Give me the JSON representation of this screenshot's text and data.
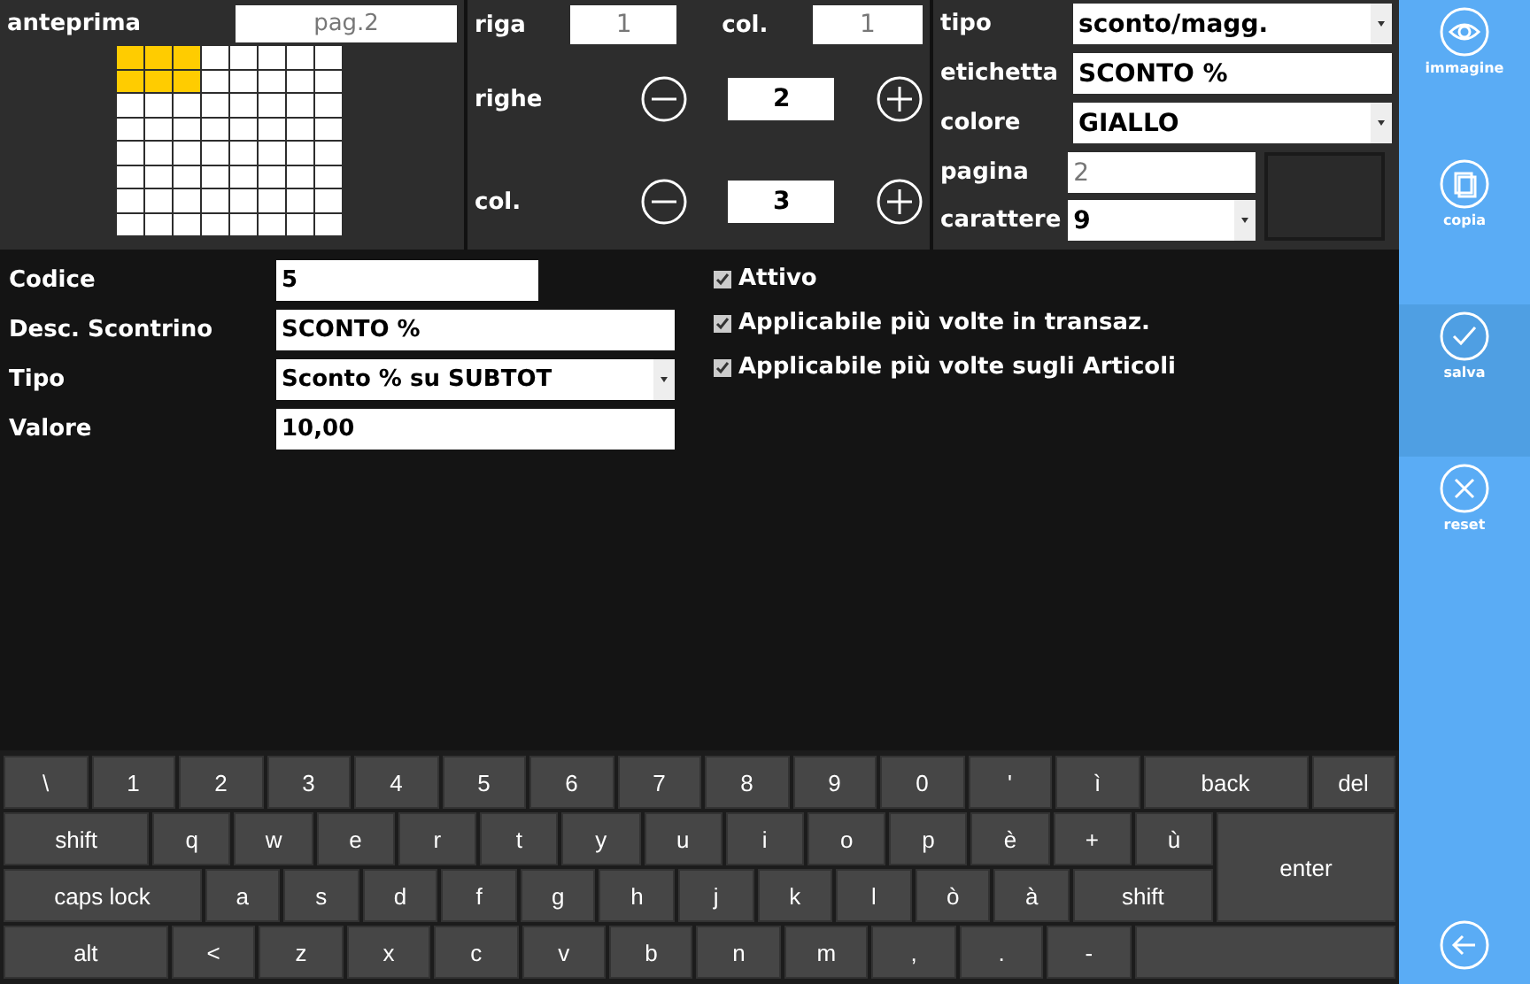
{
  "preview": {
    "label": "anteprima",
    "page": "pag.2"
  },
  "position": {
    "riga_label": "riga",
    "riga": "1",
    "col_label": "col.",
    "col": "1",
    "righe_label": "righe",
    "righe": "2",
    "cols_label": "col.",
    "cols": "3"
  },
  "button": {
    "tipo_label": "tipo",
    "tipo": "sconto/magg.",
    "etichetta_label": "etichetta",
    "etichetta": "SCONTO %",
    "colore_label": "colore",
    "colore": "GIALLO",
    "pagina_label": "pagina",
    "pagina": "2",
    "carattere_label": "carattere",
    "carattere": "9"
  },
  "form": [
    {
      "label": "Codice",
      "value": "5",
      "kind": "short"
    },
    {
      "label": "Desc. Scontrino",
      "value": "SCONTO %",
      "kind": "text"
    },
    {
      "label": "Tipo",
      "value": "Sconto % su SUBTOT",
      "kind": "select"
    },
    {
      "label": "Valore",
      "value": "10,00",
      "kind": "text"
    }
  ],
  "options": [
    {
      "label": "Attivo",
      "checked": true
    },
    {
      "label": "Applicabile più volte in transaz.",
      "checked": true
    },
    {
      "label": "Applicabile più volte sugli Articoli",
      "checked": true
    }
  ],
  "keyboard": {
    "row1": [
      "\\",
      "1",
      "2",
      "3",
      "4",
      "5",
      "6",
      "7",
      "8",
      "9",
      "0",
      "'",
      "ì",
      "back",
      "del"
    ],
    "row2": [
      "shift",
      "q",
      "w",
      "e",
      "r",
      "t",
      "y",
      "u",
      "i",
      "o",
      "p",
      "è",
      "+",
      "ù"
    ],
    "row3": [
      "caps lock",
      "a",
      "s",
      "d",
      "f",
      "g",
      "h",
      "j",
      "k",
      "l",
      "ò",
      "à",
      "shift"
    ],
    "row4": [
      "alt",
      "<",
      "z",
      "x",
      "c",
      "v",
      "b",
      "n",
      "m",
      ",",
      ".",
      "-"
    ],
    "enter": "enter"
  },
  "sidebar": [
    {
      "label": "immagine",
      "kind": "eye",
      "selected": false
    },
    {
      "label": "copia",
      "kind": "copy",
      "selected": false
    },
    {
      "label": "salva",
      "kind": "check",
      "selected": true
    },
    {
      "label": "reset",
      "kind": "x",
      "selected": false
    }
  ]
}
